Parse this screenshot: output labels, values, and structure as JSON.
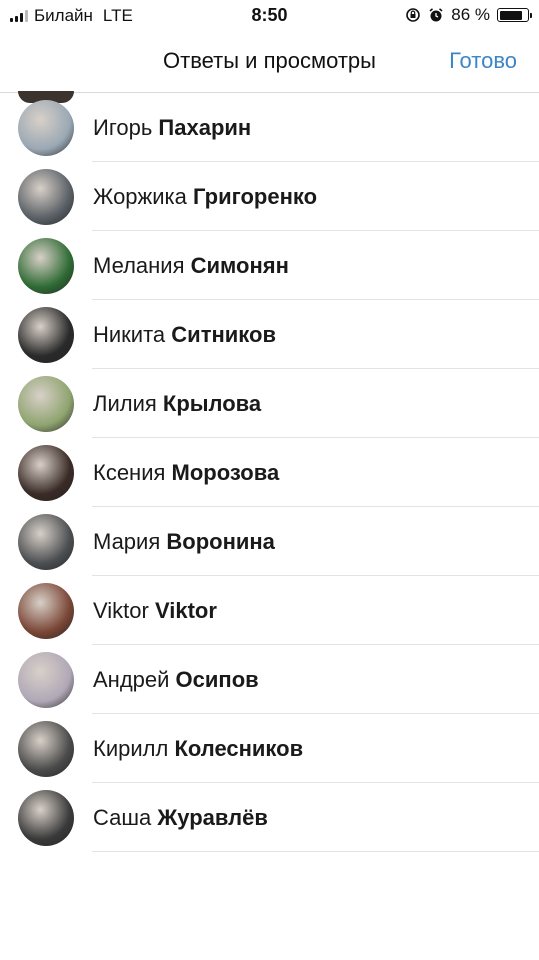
{
  "status_bar": {
    "carrier": "Билайн",
    "network": "LTE",
    "time": "8:50",
    "battery_percent": "86 %",
    "battery_level": 0.86
  },
  "header": {
    "title": "Ответы и просмотры",
    "done_label": "Готово",
    "accent_color": "#3d86c6"
  },
  "viewers": [
    {
      "first": "Игорь",
      "last": "Пахарин",
      "avatar_color": "#9aa8b4"
    },
    {
      "first": "Жоржика",
      "last": "Григоренко",
      "avatar_color": "#5a6066"
    },
    {
      "first": "Мелания",
      "last": "Симонян",
      "avatar_color": "#2f6b34"
    },
    {
      "first": "Никита",
      "last": "Ситников",
      "avatar_color": "#2a2a2a"
    },
    {
      "first": "Лилия",
      "last": "Крылова",
      "avatar_color": "#8fa470"
    },
    {
      "first": "Ксения",
      "last": "Морозова",
      "avatar_color": "#3a2b26"
    },
    {
      "first": "Мария",
      "last": "Воронина",
      "avatar_color": "#4c4f52"
    },
    {
      "first": "Viktor",
      "last": "Viktor",
      "avatar_color": "#7a4636"
    },
    {
      "first": "Андрей",
      "last": "Осипов",
      "avatar_color": "#b0a8b6"
    },
    {
      "first": "Кирилл",
      "last": "Колесников",
      "avatar_color": "#4a4a4a"
    },
    {
      "first": "Саша",
      "last": "Журавлёв",
      "avatar_color": "#3a3a3a"
    }
  ]
}
